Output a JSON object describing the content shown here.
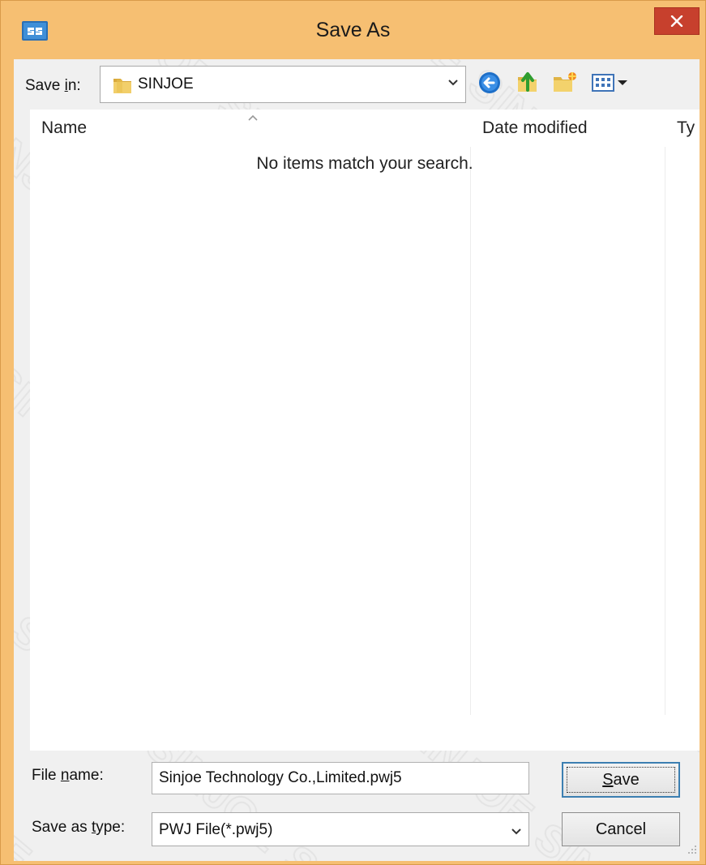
{
  "window": {
    "title": "Save As",
    "close_glyph": "✕",
    "app_icon": "sinjoe-app-icon",
    "title_bar_color": "#f6bf72",
    "close_button_color": "#c7402d"
  },
  "toolbar": {
    "save_in_label_prefix": "Save ",
    "save_in_label_accel": "i",
    "save_in_label_suffix": "n:",
    "current_folder": "SINJOE",
    "buttons": [
      {
        "name": "back-button",
        "icon": "back-arrow-icon"
      },
      {
        "name": "up-one-level-button",
        "icon": "up-folder-icon"
      },
      {
        "name": "new-folder-button",
        "icon": "new-folder-icon"
      },
      {
        "name": "view-menu-button",
        "icon": "view-menu-icon"
      }
    ]
  },
  "file_list": {
    "columns": [
      "Name",
      "Date modified",
      "Ty"
    ],
    "sorted_column": "Name",
    "empty_message": "No items match your search.",
    "items": []
  },
  "footer": {
    "file_name_label_prefix": "File ",
    "file_name_label_accel": "n",
    "file_name_label_suffix": "ame:",
    "file_name_value": "Sinjoe Technology Co.,Limited.pwj5",
    "save_type_label_prefix": "Save as ",
    "save_type_label_accel": "t",
    "save_type_label_suffix": "ype:",
    "save_type_value": "PWJ File(*.pwj5)",
    "save_accel": "S",
    "save_rest": "ave",
    "cancel_label": "Cancel"
  },
  "watermark_text": "SINJOE"
}
